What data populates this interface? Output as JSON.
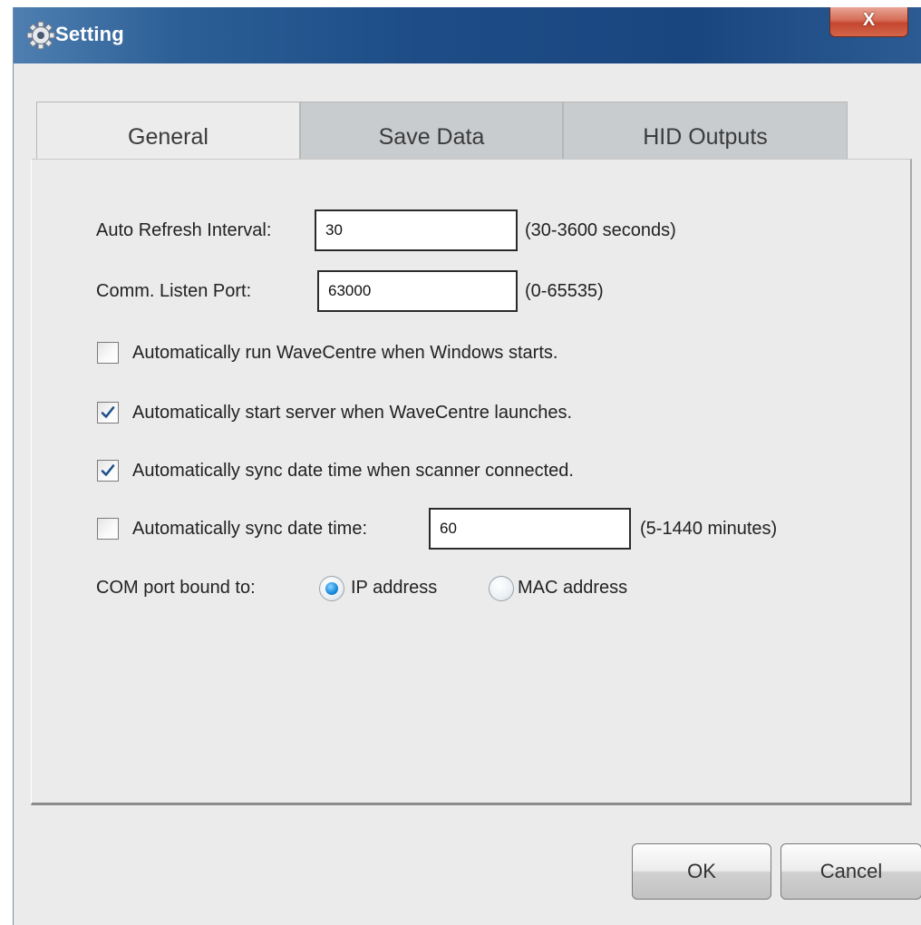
{
  "window": {
    "title": "Setting",
    "close_label": "X"
  },
  "tabs": [
    {
      "label": "General",
      "selected": true
    },
    {
      "label": "Save Data",
      "selected": false
    },
    {
      "label": "HID Outputs",
      "selected": false
    }
  ],
  "general": {
    "auto_refresh": {
      "label": "Auto Refresh Interval:",
      "value": "30",
      "hint": "(30-3600 seconds)"
    },
    "listen_port": {
      "label": "Comm. Listen Port:",
      "value": "63000",
      "hint": "(0-65535)"
    },
    "run_on_startup": {
      "label": "Automatically run WaveCentre when Windows starts.",
      "checked": false
    },
    "start_server": {
      "label": "Automatically start server when WaveCentre launches.",
      "checked": true
    },
    "sync_on_connect": {
      "label": "Automatically sync date time when scanner connected.",
      "checked": true
    },
    "sync_interval": {
      "label": "Automatically sync date time:",
      "value": "60",
      "hint": "(5-1440 minutes)",
      "checked": false
    },
    "com_port": {
      "label": "COM port bound to:",
      "options": [
        "IP address",
        "MAC address"
      ],
      "selected": "IP address"
    }
  },
  "buttons": {
    "ok": "OK",
    "cancel": "Cancel"
  },
  "colors": {
    "titlebar": "#1d4c86",
    "close_button": "#c4472f",
    "radio_selected": "#1e8fe0",
    "panel": "#ebebeb"
  },
  "icons": {
    "window": "gear-icon",
    "close": "close-icon",
    "check": "checkmark-icon"
  }
}
